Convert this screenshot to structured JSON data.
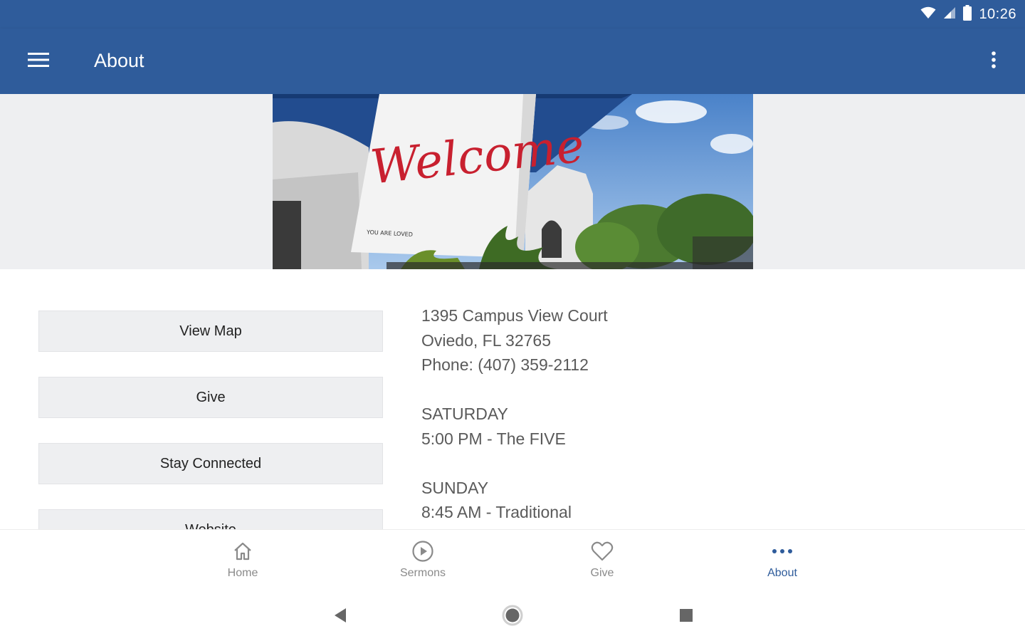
{
  "status_bar": {
    "time": "10:26",
    "icons": [
      "wifi-icon",
      "signal-icon",
      "battery-icon"
    ]
  },
  "app_bar": {
    "title": "About",
    "menu_icon": "hamburger-menu-icon",
    "overflow_icon": "more-vert-icon"
  },
  "hero": {
    "sign_text": "Welcome",
    "sign_subtext": "YOU ARE LOVED"
  },
  "buttons": [
    {
      "label": "View Map"
    },
    {
      "label": "Give"
    },
    {
      "label": "Stay Connected"
    },
    {
      "label": "Website"
    }
  ],
  "info": {
    "address_line1": "1395 Campus View Court",
    "address_line2": "Oviedo, FL 32765",
    "phone": "Phone: (407) 359-2112",
    "day1": "SATURDAY",
    "day1_service": "5:00 PM - The FIVE",
    "day2": "SUNDAY",
    "day2_service": "8:45 AM - Traditional"
  },
  "bottom_nav": {
    "items": [
      {
        "label": "Home",
        "icon": "home-icon",
        "active": false
      },
      {
        "label": "Sermons",
        "icon": "play-circle-icon",
        "active": false
      },
      {
        "label": "Give",
        "icon": "heart-icon",
        "active": false
      },
      {
        "label": "About",
        "icon": "more-horiz-icon",
        "active": true
      }
    ]
  },
  "colors": {
    "primary": "#2f5c9b",
    "button_bg": "#eeeff1",
    "text_secondary": "#5a5a5a",
    "nav_inactive": "#8a8a8a",
    "sign_red": "#c8202f"
  }
}
